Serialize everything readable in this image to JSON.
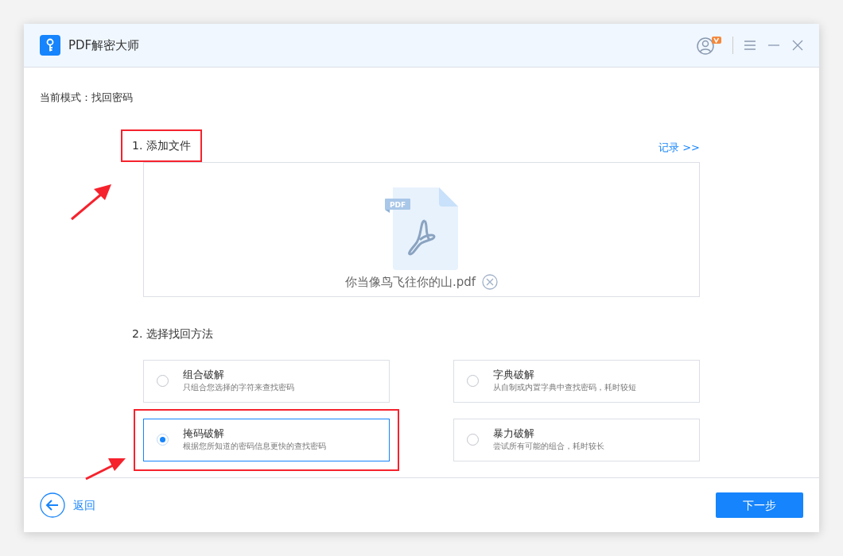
{
  "window": {
    "title": "PDF解密大师"
  },
  "mode_label": "当前模式：找回密码",
  "section_file": {
    "heading": "1. 添加文件",
    "highlighted": true,
    "history_link": "记录 >>",
    "file_name": "你当像鸟飞往你的山.pdf",
    "file_badge": "PDF"
  },
  "section_method": {
    "heading": "2. 选择找回方法",
    "highlighted": false,
    "options": [
      {
        "title": "组合破解",
        "description": "只组合您选择的字符来查找密码",
        "selected": false,
        "highlighted": false
      },
      {
        "title": "字典破解",
        "description": "从自制或内置字典中查找密码，耗时较短",
        "selected": false,
        "highlighted": false
      },
      {
        "title": "掩码破解",
        "description": "根据您所知道的密码信息更快的查找密码",
        "selected": true,
        "highlighted": true
      },
      {
        "title": "暴力破解",
        "description": "尝试所有可能的组合，耗时较长",
        "selected": false,
        "highlighted": false
      }
    ]
  },
  "footer": {
    "back": "返回",
    "next": "下一步"
  }
}
